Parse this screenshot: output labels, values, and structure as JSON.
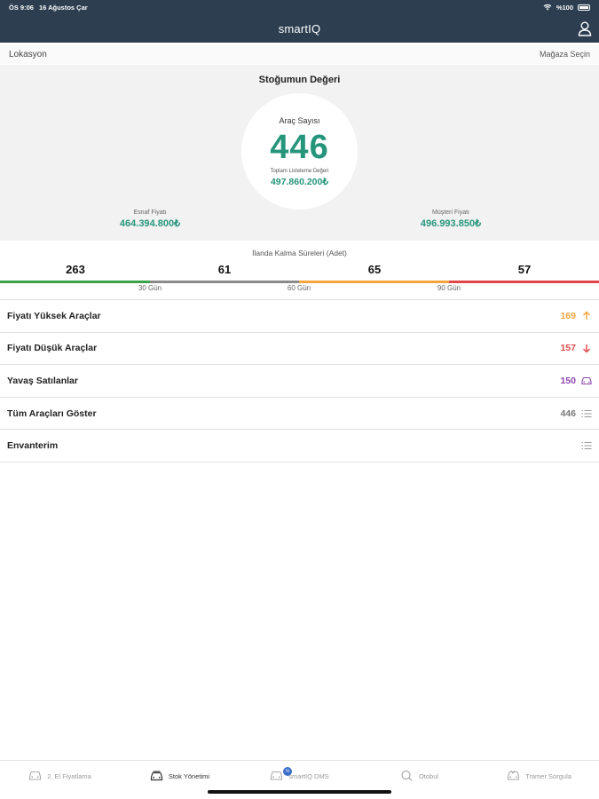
{
  "status_bar": {
    "time": "ÖS 9:06",
    "date": "16 Ağustos Çar",
    "battery": "%100"
  },
  "app": {
    "title": "smartIQ"
  },
  "location_bar": {
    "label": "Lokasyon",
    "store_select": "Mağaza Seçin"
  },
  "summary": {
    "heading": "Stoğumun Değeri",
    "vehicle_count_label": "Araç Sayısı",
    "vehicle_count": "446",
    "total_listing_label": "Toplam Listeleme Değeri",
    "total_listing_value": "497.860.200₺",
    "dealer_price_label": "Esnaf Fiyatı",
    "dealer_price_value": "464.394.800₺",
    "customer_price_label": "Müşteri Fiyatı",
    "customer_price_value": "496.993.850₺"
  },
  "durations": {
    "title": "İlanda Kalma Süreleri (Adet)",
    "counts": [
      "263",
      "61",
      "65",
      "57"
    ],
    "markers": [
      "30 Gün",
      "60 Gün",
      "90 Gün"
    ],
    "colors": [
      "#3aa24a",
      "#8a8a8a",
      "#f3a43a",
      "#e04848"
    ]
  },
  "list": [
    {
      "label": "Fiyatı Yüksek Araçlar",
      "value": "169",
      "icon": "arrow-up-icon",
      "color": "#f3a43a"
    },
    {
      "label": "Fiyatı Düşük Araçlar",
      "value": "157",
      "icon": "arrow-down-icon",
      "color": "#e04848"
    },
    {
      "label": "Yavaş Satılanlar",
      "value": "150",
      "icon": "car-icon",
      "color": "#8e44ad"
    },
    {
      "label": "Tüm Araçları Göster",
      "value": "446",
      "icon": "list-icon",
      "color": "#777777"
    },
    {
      "label": "Envanterim",
      "value": "",
      "icon": "list-icon",
      "color": "#777777"
    }
  ],
  "tabs": [
    {
      "label": "2. El Fiyatlama",
      "icon": "car-icon"
    },
    {
      "label": "Stok Yönetimi",
      "icon": "car-stack-icon"
    },
    {
      "label": "smartIQ DMS",
      "icon": "dms-car-icon",
      "badge": "N"
    },
    {
      "label": "Otobul",
      "icon": "search-icon"
    },
    {
      "label": "Tramer Sorgula",
      "icon": "damage-car-icon"
    }
  ]
}
